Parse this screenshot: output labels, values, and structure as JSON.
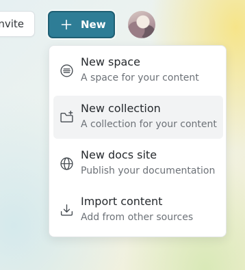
{
  "toolbar": {
    "invite_label": "nvite",
    "new_label": "New",
    "new_button_color": "#2e7d96"
  },
  "menu": {
    "items": [
      {
        "title": "New space",
        "description": "A space for your content",
        "icon": "space-icon"
      },
      {
        "title": "New collection",
        "description": "A collection for your content",
        "icon": "folder-plus-icon",
        "active": true
      },
      {
        "title": "New docs site",
        "description": "Publish your documentation",
        "icon": "globe-icon"
      },
      {
        "title": "Import content",
        "description": "Add from other sources",
        "icon": "import-icon"
      }
    ]
  }
}
